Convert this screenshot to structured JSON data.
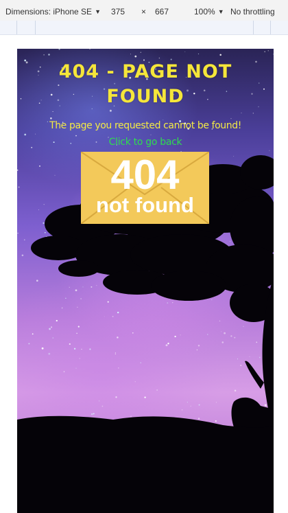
{
  "devtools": {
    "dimensions_label": "Dimensions: iPhone SE",
    "width": "375",
    "times": "×",
    "height": "667",
    "zoom": "100%",
    "throttling": "No throttling"
  },
  "page": {
    "title": "404 - PAGE NOT FOUND",
    "subtitle": "The page you requested cannot be found!",
    "back_link": "Click to go back",
    "envelope_code": "404",
    "envelope_text": "not found"
  },
  "colors": {
    "title": "#f5e63a",
    "subtitle": "#f3ea45",
    "link": "#2fdc4f",
    "envelope": "#f3c95a"
  },
  "icons": [
    "caret-down-icon"
  ]
}
